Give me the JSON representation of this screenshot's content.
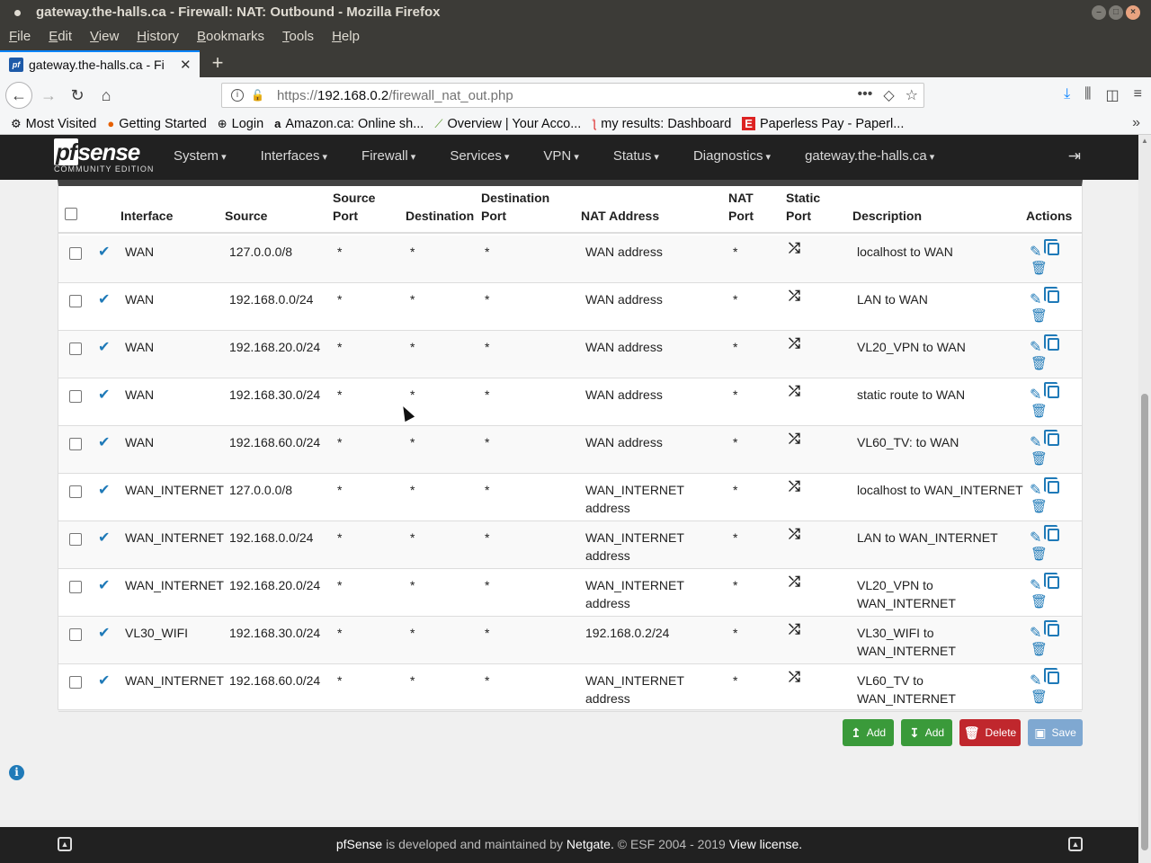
{
  "window": {
    "title": "gateway.the-halls.ca - Firewall: NAT: Outbound - Mozilla Firefox"
  },
  "menu": [
    "File",
    "Edit",
    "View",
    "History",
    "Bookmarks",
    "Tools",
    "Help"
  ],
  "tab": {
    "title": "gateway.the-halls.ca - Fi",
    "favicon": "pf"
  },
  "urlbar": {
    "prefix": "https://",
    "host": "192.168.0.2",
    "path": "/firewall_nat_out.php"
  },
  "bookmarks": [
    {
      "icon": "gear-icon",
      "label": "Most Visited"
    },
    {
      "icon": "firefox-icon",
      "label": "Getting Started"
    },
    {
      "icon": "globe-icon",
      "label": "Login"
    },
    {
      "icon": "amazon-icon",
      "label": "Amazon.ca: Online sh..."
    },
    {
      "icon": "overview-icon",
      "label": "Overview | Your Acco..."
    },
    {
      "icon": "runner-icon",
      "label": "my results: Dashboard"
    },
    {
      "icon": "paperless-icon",
      "label": "Paperless Pay - Paperl..."
    }
  ],
  "pfsense": {
    "logo": "sense",
    "logo_prefix": "pf",
    "edition": "COMMUNITY EDITION",
    "nav": [
      "System",
      "Interfaces",
      "Firewall",
      "Services",
      "VPN",
      "Status",
      "Diagnostics",
      "gateway.the-halls.ca"
    ]
  },
  "table": {
    "headers": {
      "interface": "Interface",
      "source": "Source",
      "source_port": "Source Port",
      "destination": "Destination",
      "destination_port": "Destination Port",
      "nat_address": "NAT Address",
      "nat_port": "NAT Port",
      "static_port": "Static Port",
      "description": "Description",
      "actions": "Actions"
    },
    "rows": [
      {
        "interface": "WAN",
        "source": "127.0.0.0/8",
        "sport": "*",
        "dest": "*",
        "dport": "*",
        "nat": "WAN address",
        "natport": "*",
        "desc": "localhost to WAN"
      },
      {
        "interface": "WAN",
        "source": "192.168.0.0/24",
        "sport": "*",
        "dest": "*",
        "dport": "*",
        "nat": "WAN address",
        "natport": "*",
        "desc": "LAN to WAN"
      },
      {
        "interface": "WAN",
        "source": "192.168.20.0/24",
        "sport": "*",
        "dest": "*",
        "dport": "*",
        "nat": "WAN address",
        "natport": "*",
        "desc": "VL20_VPN to WAN"
      },
      {
        "interface": "WAN",
        "source": "192.168.30.0/24",
        "sport": "*",
        "dest": "*",
        "dport": "*",
        "nat": "WAN address",
        "natport": "*",
        "desc": "static route to WAN"
      },
      {
        "interface": "WAN",
        "source": "192.168.60.0/24",
        "sport": "*",
        "dest": "*",
        "dport": "*",
        "nat": "WAN address",
        "natport": "*",
        "desc": "VL60_TV: to WAN"
      },
      {
        "interface": "WAN_INTERNET",
        "source": "127.0.0.0/8",
        "sport": "*",
        "dest": "*",
        "dport": "*",
        "nat": "WAN_INTERNET address",
        "natport": "*",
        "desc": "localhost to WAN_INTERNET"
      },
      {
        "interface": "WAN_INTERNET",
        "source": "192.168.0.0/24",
        "sport": "*",
        "dest": "*",
        "dport": "*",
        "nat": "WAN_INTERNET address",
        "natport": "*",
        "desc": "LAN to WAN_INTERNET"
      },
      {
        "interface": "WAN_INTERNET",
        "source": "192.168.20.0/24",
        "sport": "*",
        "dest": "*",
        "dport": "*",
        "nat": "WAN_INTERNET address",
        "natport": "*",
        "desc": "VL20_VPN to WAN_INTERNET"
      },
      {
        "interface": "VL30_WIFI",
        "source": "192.168.30.0/24",
        "sport": "*",
        "dest": "*",
        "dport": "*",
        "nat": "192.168.0.2/24",
        "natport": "*",
        "desc": "VL30_WIFI to WAN_INTERNET"
      },
      {
        "interface": "WAN_INTERNET",
        "source": "192.168.60.0/24",
        "sport": "*",
        "dest": "*",
        "dport": "*",
        "nat": "WAN_INTERNET address",
        "natport": "*",
        "desc": "VL60_TV to WAN_INTERNET"
      }
    ]
  },
  "buttons": {
    "add_top": "Add",
    "add_bottom": "Add",
    "delete": "Delete",
    "save": "Save"
  },
  "footer": {
    "brand": "pfSense",
    "text1": " is developed and maintained by ",
    "company": "Netgate.",
    "text2": " © ESF 2004 - 2019 ",
    "license": "View license."
  },
  "colors": {
    "accent": "#1f7ab8",
    "header_bg": "#212121",
    "add_green": "#3a9a3a",
    "delete_red": "#c0272d",
    "save_blue": "#7fa8d1"
  }
}
